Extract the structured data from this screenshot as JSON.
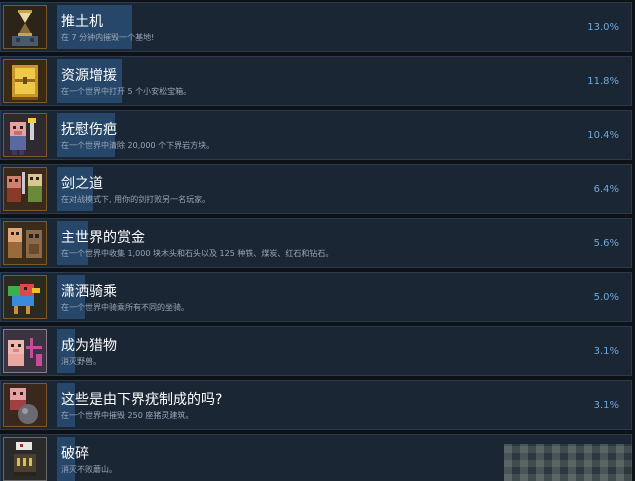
{
  "achievements": [
    {
      "title": "推土机",
      "desc": "在 7 分钟内摧毁一个基地!",
      "pct": "13.0%",
      "fill": 0.13,
      "icon": "hourglass-tower-icon"
    },
    {
      "title": "资源增援",
      "desc": "在一个世界中打开 5 个小安松宝箱。",
      "pct": "11.8%",
      "fill": 0.118,
      "icon": "golden-chest-icon"
    },
    {
      "title": "抚慰伤疤",
      "desc": "在一个世界中清除 20,000 个下界岩方块。",
      "pct": "10.4%",
      "fill": 0.104,
      "icon": "piglin-wrench-icon"
    },
    {
      "title": "剑之道",
      "desc": "在对战模式下, 用你的剑打败另一名玩家。",
      "pct": "6.4%",
      "fill": 0.064,
      "icon": "two-fighters-icon"
    },
    {
      "title": "主世界的赏金",
      "desc": "在一个世界中收集 1,000 块木头和石头以及 125 种铁、煤炭、红石和钻石。",
      "pct": "5.6%",
      "fill": 0.056,
      "icon": "resource-golem-icon"
    },
    {
      "title": "潇洒骑乘",
      "desc": "在一个世界中骑乘所有不同的坐骑。",
      "pct": "5.0%",
      "fill": 0.05,
      "icon": "bird-mount-icon"
    },
    {
      "title": "成为猎物",
      "desc": "消灭野兽。",
      "pct": "3.1%",
      "fill": 0.031,
      "icon": "pig-prey-icon"
    },
    {
      "title": "这些是由下界疣制成的吗?",
      "desc": "在一个世界中摧毁 250 座猪灵建筑。",
      "pct": "3.1%",
      "fill": 0.031,
      "icon": "piglin-cannonball-icon"
    },
    {
      "title": "破碎",
      "desc": "消灭不败蘑山。",
      "pct": "",
      "fill": 0.031,
      "icon": "mushroom-structure-icon"
    }
  ]
}
